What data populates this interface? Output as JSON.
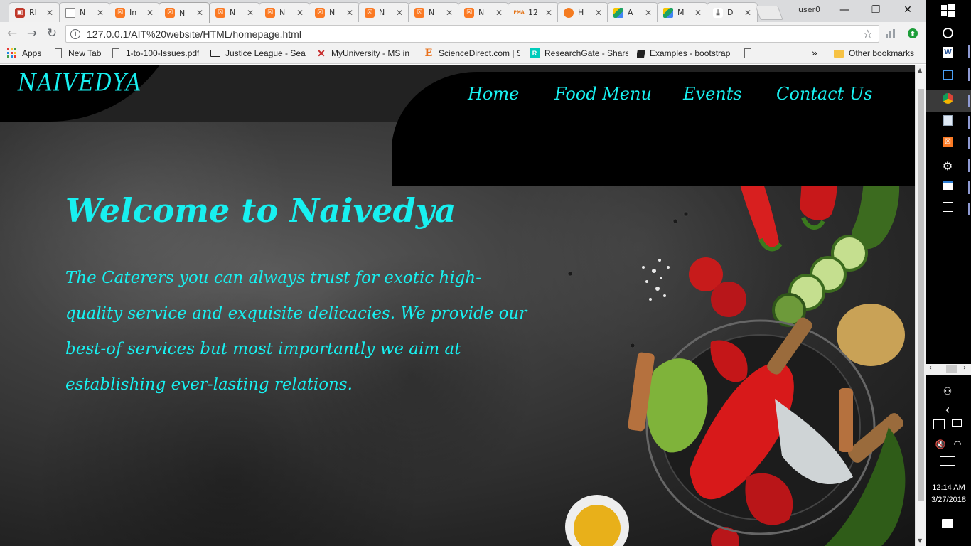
{
  "tabs": [
    {
      "label": "RI",
      "icon": "red-app-icon"
    },
    {
      "label": "N",
      "icon": "document-icon"
    },
    {
      "label": "In",
      "icon": "xampp-icon"
    },
    {
      "label": "N",
      "icon": "xampp-icon",
      "active": true
    },
    {
      "label": "N",
      "icon": "xampp-icon"
    },
    {
      "label": "N",
      "icon": "xampp-icon"
    },
    {
      "label": "N",
      "icon": "xampp-icon"
    },
    {
      "label": "N",
      "icon": "xampp-icon"
    },
    {
      "label": "N",
      "icon": "xampp-icon"
    },
    {
      "label": "N",
      "icon": "xampp-icon"
    },
    {
      "label": "12",
      "icon": "phpmyadmin-icon"
    },
    {
      "label": "H",
      "icon": "orange-app-icon"
    },
    {
      "label": "A",
      "icon": "google-drive-icon"
    },
    {
      "label": "M",
      "icon": "google-drive-icon"
    },
    {
      "label": "D",
      "icon": "download-icon"
    }
  ],
  "window": {
    "user": "user0",
    "minimize": "—",
    "maximize": "❐",
    "close": "✕"
  },
  "toolbar": {
    "url": "127.0.0.1/AIT%20website/HTML/homepage.html"
  },
  "bookmarks": [
    {
      "label": "Apps",
      "icon": "apps-grid-icon"
    },
    {
      "label": "New Tab",
      "icon": "page-icon"
    },
    {
      "label": "1-to-100-Issues.pdf",
      "icon": "page-icon"
    },
    {
      "label": "Justice League - Seas",
      "icon": "tv-icon"
    },
    {
      "label": "MyUniversity - MS in",
      "icon": "x-logo-icon"
    },
    {
      "label": "ScienceDirect.com | S",
      "icon": "elsevier-icon"
    },
    {
      "label": "ResearchGate - Share",
      "icon": "researchgate-icon"
    },
    {
      "label": "Examples - bootstrap",
      "icon": "book-icon"
    },
    {
      "label": "",
      "icon": "page-icon"
    },
    {
      "label": "»",
      "icon": "overflow-chevron-icon"
    },
    {
      "label": "Other bookmarks",
      "icon": "folder-icon"
    }
  ],
  "site": {
    "brand": "NAIVEDYA",
    "nav": [
      "Home",
      "Food Menu",
      "Events",
      "Contact Us"
    ],
    "hero_title": "Welcome to Naivedya",
    "hero_text": "The Caterers you can always trust for exotic high-quality service and exquisite delicacies. We provide our best-of services but most importantly we aim at establishing ever-lasting relations.",
    "accent_color": "#18f0f0"
  },
  "taskbar": {
    "time": "12:14 AM",
    "date": "3/27/2018"
  }
}
